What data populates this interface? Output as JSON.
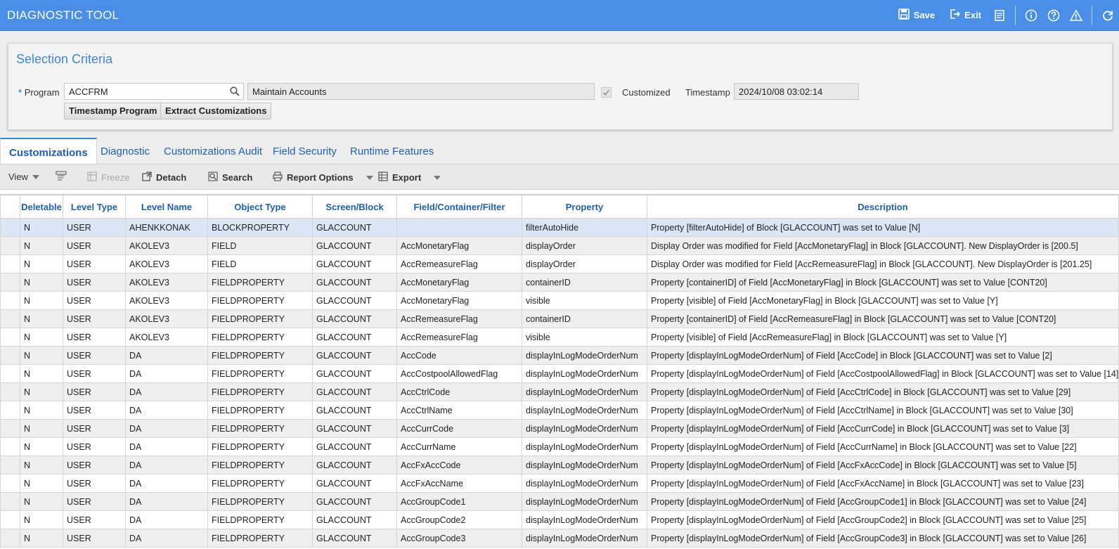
{
  "app": {
    "title": "DIAGNOSTIC TOOL"
  },
  "header_actions": {
    "save": "Save",
    "exit": "Exit"
  },
  "selection": {
    "title": "Selection Criteria",
    "program_label": "Program",
    "required_mark": "*",
    "program_value": "ACCFRM",
    "program_desc": "Maintain Accounts",
    "customized_label": "Customized",
    "customized_checked": true,
    "timestamp_label": "Timestamp",
    "timestamp_value": "2024/10/08 03:02:14",
    "btn_timestamp": "Timestamp Program",
    "btn_extract": "Extract Customizations"
  },
  "tabs": [
    "Customizations",
    "Diagnostic",
    "Customizations Audit",
    "Field Security",
    "Runtime Features"
  ],
  "active_tab": "Customizations",
  "toolbar": {
    "view": "View",
    "freeze": "Freeze",
    "detach": "Detach",
    "search": "Search",
    "report_options": "Report Options",
    "export": "Export"
  },
  "grid": {
    "columns": [
      "Deletable",
      "Level Type",
      "Level Name",
      "Object Type",
      "Screen/Block",
      "Field/Container/Filter",
      "Property",
      "Description"
    ],
    "rows": [
      [
        "N",
        "USER",
        "AHENKKONAK",
        "BLOCKPROPERTY",
        "GLACCOUNT",
        "",
        "filterAutoHide",
        "Property [filterAutoHide] of Block [GLACCOUNT] was set to Value [N]"
      ],
      [
        "N",
        "USER",
        "AKOLEV3",
        "FIELD",
        "GLACCOUNT",
        "AccMonetaryFlag",
        "displayOrder",
        "Display Order was modified for Field [AccMonetaryFlag] in Block [GLACCOUNT]. New DisplayOrder is [200.5]"
      ],
      [
        "N",
        "USER",
        "AKOLEV3",
        "FIELD",
        "GLACCOUNT",
        "AccRemeasureFlag",
        "displayOrder",
        "Display Order was modified for Field [AccRemeasureFlag] in Block [GLACCOUNT]. New DisplayOrder is [201.25]"
      ],
      [
        "N",
        "USER",
        "AKOLEV3",
        "FIELDPROPERTY",
        "GLACCOUNT",
        "AccMonetaryFlag",
        "containerID",
        "Property [containerID] of Field [AccMonetaryFlag] in Block [GLACCOUNT] was set to Value [CONT20]"
      ],
      [
        "N",
        "USER",
        "AKOLEV3",
        "FIELDPROPERTY",
        "GLACCOUNT",
        "AccMonetaryFlag",
        "visible",
        "Property [visible] of Field [AccMonetaryFlag] in Block [GLACCOUNT] was set to Value [Y]"
      ],
      [
        "N",
        "USER",
        "AKOLEV3",
        "FIELDPROPERTY",
        "GLACCOUNT",
        "AccRemeasureFlag",
        "containerID",
        "Property [containerID] of Field [AccRemeasureFlag] in Block [GLACCOUNT] was set to Value [CONT20]"
      ],
      [
        "N",
        "USER",
        "AKOLEV3",
        "FIELDPROPERTY",
        "GLACCOUNT",
        "AccRemeasureFlag",
        "visible",
        "Property [visible] of Field [AccRemeasureFlag] in Block [GLACCOUNT] was set to Value [Y]"
      ],
      [
        "N",
        "USER",
        "DA",
        "FIELDPROPERTY",
        "GLACCOUNT",
        "AccCode",
        "displayInLogModeOrderNum",
        "Property [displayInLogModeOrderNum] of Field [AccCode] in Block [GLACCOUNT] was set to Value [2]"
      ],
      [
        "N",
        "USER",
        "DA",
        "FIELDPROPERTY",
        "GLACCOUNT",
        "AccCostpoolAllowedFlag",
        "displayInLogModeOrderNum",
        "Property [displayInLogModeOrderNum] of Field [AccCostpoolAllowedFlag] in Block [GLACCOUNT] was set to Value [14]"
      ],
      [
        "N",
        "USER",
        "DA",
        "FIELDPROPERTY",
        "GLACCOUNT",
        "AccCtrlCode",
        "displayInLogModeOrderNum",
        "Property [displayInLogModeOrderNum] of Field [AccCtrlCode] in Block [GLACCOUNT] was set to Value [29]"
      ],
      [
        "N",
        "USER",
        "DA",
        "FIELDPROPERTY",
        "GLACCOUNT",
        "AccCtrlName",
        "displayInLogModeOrderNum",
        "Property [displayInLogModeOrderNum] of Field [AccCtrlName] in Block [GLACCOUNT] was set to Value [30]"
      ],
      [
        "N",
        "USER",
        "DA",
        "FIELDPROPERTY",
        "GLACCOUNT",
        "AccCurrCode",
        "displayInLogModeOrderNum",
        "Property [displayInLogModeOrderNum] of Field [AccCurrCode] in Block [GLACCOUNT] was set to Value [3]"
      ],
      [
        "N",
        "USER",
        "DA",
        "FIELDPROPERTY",
        "GLACCOUNT",
        "AccCurrName",
        "displayInLogModeOrderNum",
        "Property [displayInLogModeOrderNum] of Field [AccCurrName] in Block [GLACCOUNT] was set to Value [22]"
      ],
      [
        "N",
        "USER",
        "DA",
        "FIELDPROPERTY",
        "GLACCOUNT",
        "AccFxAccCode",
        "displayInLogModeOrderNum",
        "Property [displayInLogModeOrderNum] of Field [AccFxAccCode] in Block [GLACCOUNT] was set to Value [5]"
      ],
      [
        "N",
        "USER",
        "DA",
        "FIELDPROPERTY",
        "GLACCOUNT",
        "AccFxAccName",
        "displayInLogModeOrderNum",
        "Property [displayInLogModeOrderNum] of Field [AccFxAccName] in Block [GLACCOUNT] was set to Value [23]"
      ],
      [
        "N",
        "USER",
        "DA",
        "FIELDPROPERTY",
        "GLACCOUNT",
        "AccGroupCode1",
        "displayInLogModeOrderNum",
        "Property [displayInLogModeOrderNum] of Field [AccGroupCode1] in Block [GLACCOUNT] was set to Value [24]"
      ],
      [
        "N",
        "USER",
        "DA",
        "FIELDPROPERTY",
        "GLACCOUNT",
        "AccGroupCode2",
        "displayInLogModeOrderNum",
        "Property [displayInLogModeOrderNum] of Field [AccGroupCode2] in Block [GLACCOUNT] was set to Value [25]"
      ],
      [
        "N",
        "USER",
        "DA",
        "FIELDPROPERTY",
        "GLACCOUNT",
        "AccGroupCode3",
        "displayInLogModeOrderNum",
        "Property [displayInLogModeOrderNum] of Field [AccGroupCode3] in Block [GLACCOUNT] was set to Value [26]"
      ]
    ],
    "selected_row": 0
  },
  "colors": {
    "header": "#4a8fe7",
    "accent": "#3f86d8",
    "link": "#1f5fb5",
    "selected_row": "#dbe6f7"
  }
}
